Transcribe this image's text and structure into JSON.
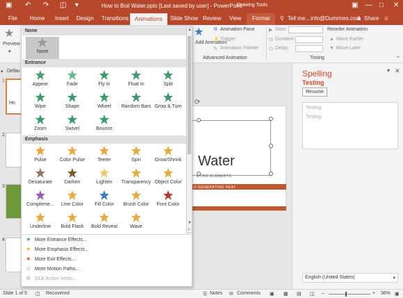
{
  "titlebar": {
    "file_title": "How to Boil Water.pptx [Last saved by user] - PowerPoint",
    "context_title": "Drawing Tools",
    "colors": {
      "accent": "#b7472a",
      "ribbon_bg": "#f3f3f3"
    }
  },
  "tabs": {
    "file": "File",
    "home": "Home",
    "insert": "Insert",
    "design": "Design",
    "transitions": "Transitions",
    "animations": "Animations",
    "slideshow": "Slide Show",
    "review": "Review",
    "view": "View",
    "format": "Format",
    "tellme": "Tell me...",
    "account": "info@Dummies.com",
    "share": "Share"
  },
  "ribbon": {
    "preview": "Preview",
    "add_animation": "Add Animation",
    "animation_pane": "Animation Pane",
    "trigger": "Trigger",
    "animation_painter": "Animation Painter",
    "advanced_group": "Advanced Animation",
    "start": "Start:",
    "duration": "Duration:",
    "delay": "Delay:",
    "reorder": "Reorder Animation",
    "move_earlier": "Move Earlier",
    "move_later": "Move Later",
    "timing_group": "Timing"
  },
  "thumbs": {
    "pane_label": "Defau",
    "slides": [
      "1",
      "2",
      "3",
      "4"
    ],
    "slide1_text": "Ho"
  },
  "slide": {
    "title": "Water",
    "sub1": "ATING ELEMENTS",
    "sub2": "D GENERATING HEAT"
  },
  "spelling": {
    "title": "Spelling",
    "word": "Testing",
    "resume": "Resume",
    "suggestions": [
      "Testing",
      "Testing"
    ],
    "language": "English (United States)"
  },
  "status": {
    "slide": "Slide 1 of 5",
    "recovered": "Recovered",
    "notes": "Notes",
    "comments": "Comments",
    "zoom": "36%"
  },
  "gallery": {
    "none_header": "None",
    "none_item": "None",
    "entrance_header": "Entrance",
    "emphasis_header": "Emphasis",
    "entrance": [
      {
        "label": "Appear",
        "color": "#4a9c72",
        "icon": "appear-star-icon"
      },
      {
        "label": "Fade",
        "color": "#6ab490",
        "icon": "fade-star-icon"
      },
      {
        "label": "Fly In",
        "color": "#3c9b6f",
        "icon": "fly-in-star-icon"
      },
      {
        "label": "Float In",
        "color": "#3c9b6f",
        "icon": "float-in-star-icon"
      },
      {
        "label": "Split",
        "color": "#3c9b6f",
        "icon": "split-star-icon"
      },
      {
        "label": "Wipe",
        "color": "#3c9b6f",
        "icon": "wipe-star-icon"
      },
      {
        "label": "Shape",
        "color": "#3c9b6f",
        "icon": "shape-star-icon"
      },
      {
        "label": "Wheel",
        "color": "#3c9b6f",
        "icon": "wheel-star-icon"
      },
      {
        "label": "Random Bars",
        "color": "#3c9b6f",
        "icon": "random-bars-star-icon"
      },
      {
        "label": "Grow & Turn",
        "color": "#3c9b6f",
        "icon": "grow-turn-star-icon"
      },
      {
        "label": "Zoom",
        "color": "#3c9b6f",
        "icon": "zoom-star-icon"
      },
      {
        "label": "Swivel",
        "color": "#3c9b6f",
        "icon": "swivel-star-icon"
      },
      {
        "label": "Bounce",
        "color": "#3c9b6f",
        "icon": "bounce-star-icon"
      }
    ],
    "emphasis": [
      {
        "label": "Pulse",
        "color": "#e8a93a",
        "icon": "pulse-star-icon"
      },
      {
        "label": "Color Pulse",
        "color": "#e8a93a",
        "icon": "color-pulse-star-icon"
      },
      {
        "label": "Teeter",
        "color": "#e8a93a",
        "icon": "teeter-star-icon"
      },
      {
        "label": "Spin",
        "color": "#e8a93a",
        "icon": "spin-star-icon"
      },
      {
        "label": "Grow/Shrink",
        "color": "#e8a93a",
        "icon": "grow-shrink-star-icon"
      },
      {
        "label": "Desaturate",
        "color": "#8a7a5a",
        "icon": "desaturate-star-icon"
      },
      {
        "label": "Darken",
        "color": "#7a5a2a",
        "icon": "darken-star-icon"
      },
      {
        "label": "Lighten",
        "color": "#f0c870",
        "icon": "lighten-star-icon"
      },
      {
        "label": "Transparency",
        "color": "#e8a93a",
        "icon": "transparency-star-icon"
      },
      {
        "label": "Object Color",
        "color": "#e8a93a",
        "icon": "object-color-star-icon"
      },
      {
        "label": "Compleme...",
        "color": "#9b59b6",
        "icon": "complementary-star-icon"
      },
      {
        "label": "Line Color",
        "color": "#e8a93a",
        "icon": "line-color-star-icon"
      },
      {
        "label": "Fill Color",
        "color": "#3c7bc0",
        "icon": "fill-color-star-icon"
      },
      {
        "label": "Brush Color",
        "color": "#e8a93a",
        "icon": "brush-color-star-icon"
      },
      {
        "label": "Font Color",
        "color": "#c0392b",
        "icon": "font-color-star-icon"
      },
      {
        "label": "Underline",
        "color": "#e8a93a",
        "icon": "underline-star-icon"
      },
      {
        "label": "Bold Flash",
        "color": "#e8a93a",
        "icon": "bold-flash-star-icon"
      },
      {
        "label": "Bold Reveal",
        "color": "#e8a93a",
        "icon": "bold-reveal-star-icon"
      },
      {
        "label": "Wave",
        "color": "#e8a93a",
        "icon": "wave-star-icon"
      }
    ],
    "more": [
      {
        "label": "More Entrance Effects...",
        "color": "#3c9b6f"
      },
      {
        "label": "More Emphasis Effects...",
        "color": "#e8a93a"
      },
      {
        "label": "More Exit Effects...",
        "color": "#d9502a"
      },
      {
        "label": "More Motion Paths...",
        "color": "#555555"
      },
      {
        "label": "OLE Action Verbs...",
        "color": "#aaaaaa"
      }
    ]
  }
}
